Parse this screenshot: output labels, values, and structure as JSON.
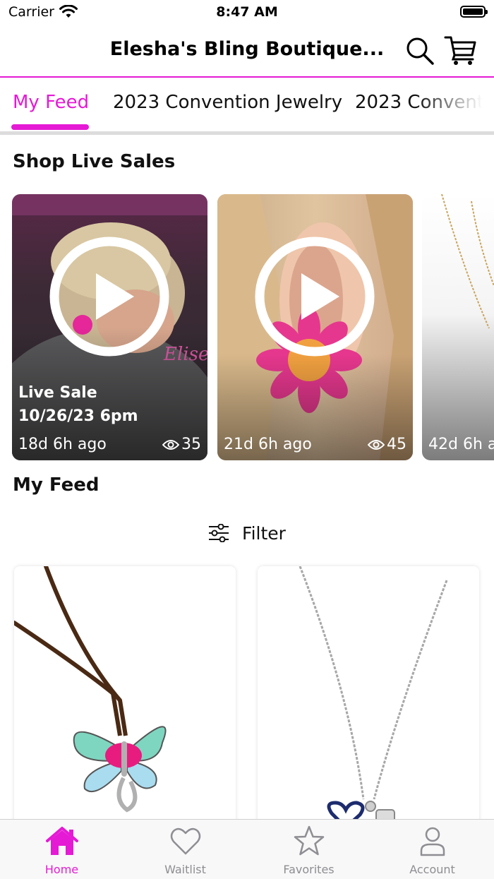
{
  "status_bar": {
    "carrier": "Carrier",
    "time": "8:47 AM"
  },
  "header": {
    "title": "Elesha's Bling Boutique...",
    "icons": [
      "search-icon",
      "cart-icon"
    ]
  },
  "tabs": [
    {
      "label": "My Feed",
      "active": true
    },
    {
      "label": "2023 Convention Jewelry",
      "active": false
    },
    {
      "label": "2023 Conventi",
      "active": false
    }
  ],
  "live_sales": {
    "title": "Shop Live Sales",
    "cards": [
      {
        "caption_line1": "Live Sale",
        "caption_line2": "10/26/23 6pm",
        "ago": "18d 6h ago",
        "views": "35"
      },
      {
        "caption_line1": "",
        "caption_line2": "",
        "ago": "21d 6h ago",
        "views": "45"
      },
      {
        "caption_line1": "",
        "caption_line2": "",
        "ago": "42d 6h a",
        "views": ""
      }
    ]
  },
  "feed": {
    "title": "My Feed",
    "filter_label": "Filter"
  },
  "tab_bar": [
    {
      "label": "Home",
      "icon": "home-icon",
      "active": true
    },
    {
      "label": "Waitlist",
      "icon": "heart-icon",
      "active": false
    },
    {
      "label": "Favorites",
      "icon": "star-icon",
      "active": false
    },
    {
      "label": "Account",
      "icon": "person-icon",
      "active": false
    }
  ],
  "colors": {
    "accent": "#e51ad5",
    "inactive": "#8e8e93",
    "divider": "#dcdcdc"
  }
}
